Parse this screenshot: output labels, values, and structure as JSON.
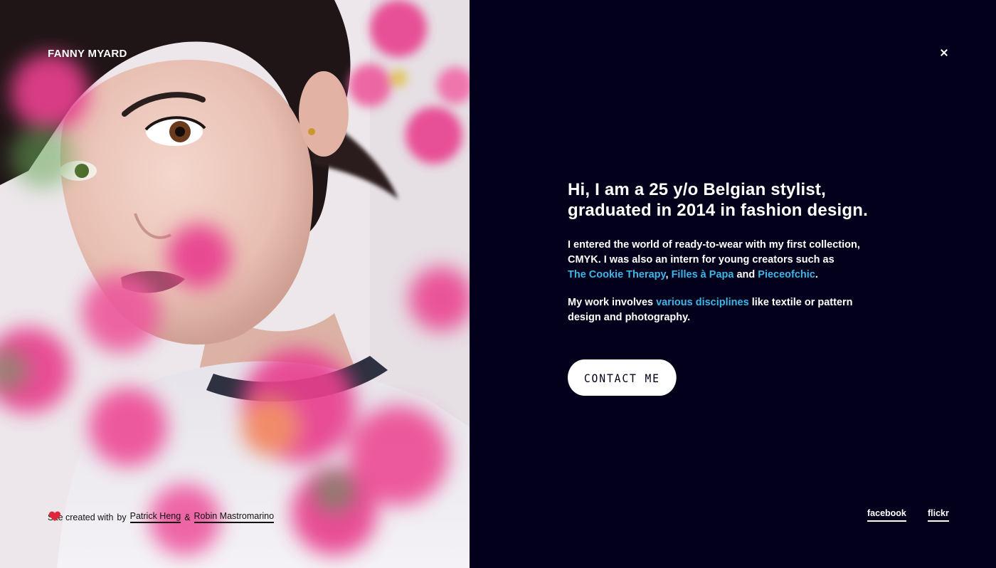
{
  "brand": {
    "name": "FANNY MYARD"
  },
  "about": {
    "heading_line1": "Hi, I am a 25 y/o Belgian stylist,",
    "heading_line2": "graduated in 2014 in fashion design.",
    "p1_text_a": "I entered the world of ready-to-wear with my first collection, CMYK. I was also an intern for young creators such as",
    "p1_link1": "The Cookie Therapy",
    "p1_sep1": ", ",
    "p1_link2": "Filles à Papa",
    "p1_sep2": " and ",
    "p1_link3": "Pieceofchic",
    "p1_end": ".",
    "p2_text_a": "My work involves ",
    "p2_link": "various disciplines",
    "p2_text_b": " like textile or pattern design and photography."
  },
  "contact": {
    "label": "CONTACT ME"
  },
  "credit": {
    "prefix": "Site created with",
    "by": "by",
    "author1": "Patrick Heng",
    "amp": "&",
    "author2": "Robin Mastromarino"
  },
  "social": {
    "facebook": "facebook",
    "flickr": "flickr"
  },
  "colors": {
    "panel_bg": "#02001a",
    "link_accent": "#3fb6e8",
    "flower_pink": "#e8408e",
    "heart_red": "#e0263a"
  },
  "icons": {
    "close": "close-icon",
    "heart": "heart-icon"
  }
}
